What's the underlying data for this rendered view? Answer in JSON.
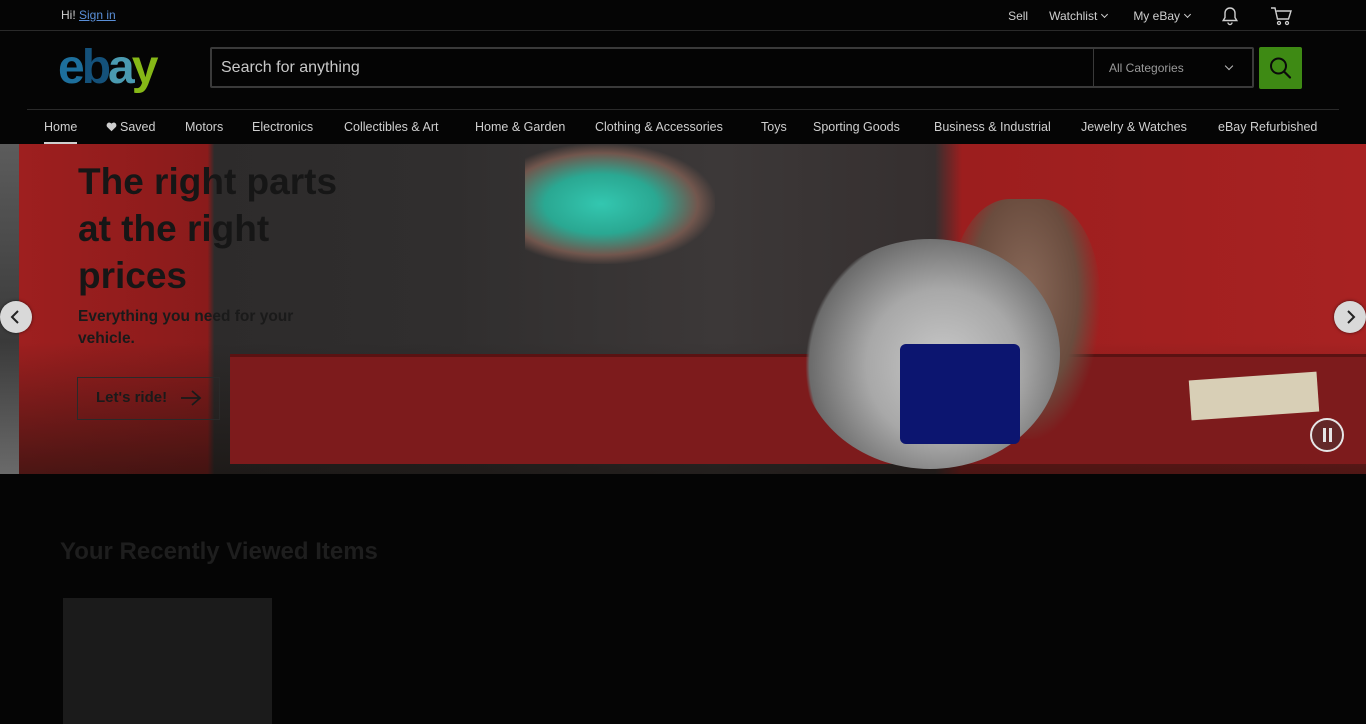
{
  "topbar": {
    "greeting": "Hi!",
    "sign_in": "Sign in",
    "sell": "Sell",
    "watchlist": "Watchlist",
    "my_ebay": "My eBay"
  },
  "logo": {
    "e": "e",
    "b": "b",
    "a": "a",
    "y": "y"
  },
  "search": {
    "placeholder": "Search for anything",
    "category": "All Categories"
  },
  "nav": {
    "tabs": [
      "Home",
      "Saved",
      "Motors",
      "Electronics",
      "Collectibles & Art",
      "Home & Garden",
      "Clothing & Accessories",
      "Toys",
      "Sporting Goods",
      "Business & Industrial",
      "Jewelry & Watches",
      "eBay Refurbished"
    ]
  },
  "hero": {
    "title": "The right parts at the right prices",
    "subtitle": "Everything you need for your vehicle.",
    "cta": "Let's ride!"
  },
  "recently_viewed": {
    "title": "Your Recently Viewed Items"
  },
  "colors": {
    "accent_green": "#3e8a14",
    "link_blue": "#5a8fd8",
    "background": "#050505"
  },
  "icons": [
    "heart-icon",
    "bell-icon",
    "cart-icon",
    "search-icon",
    "chevron-left-icon",
    "chevron-right-icon",
    "arrow-right-icon",
    "pause-icon"
  ]
}
